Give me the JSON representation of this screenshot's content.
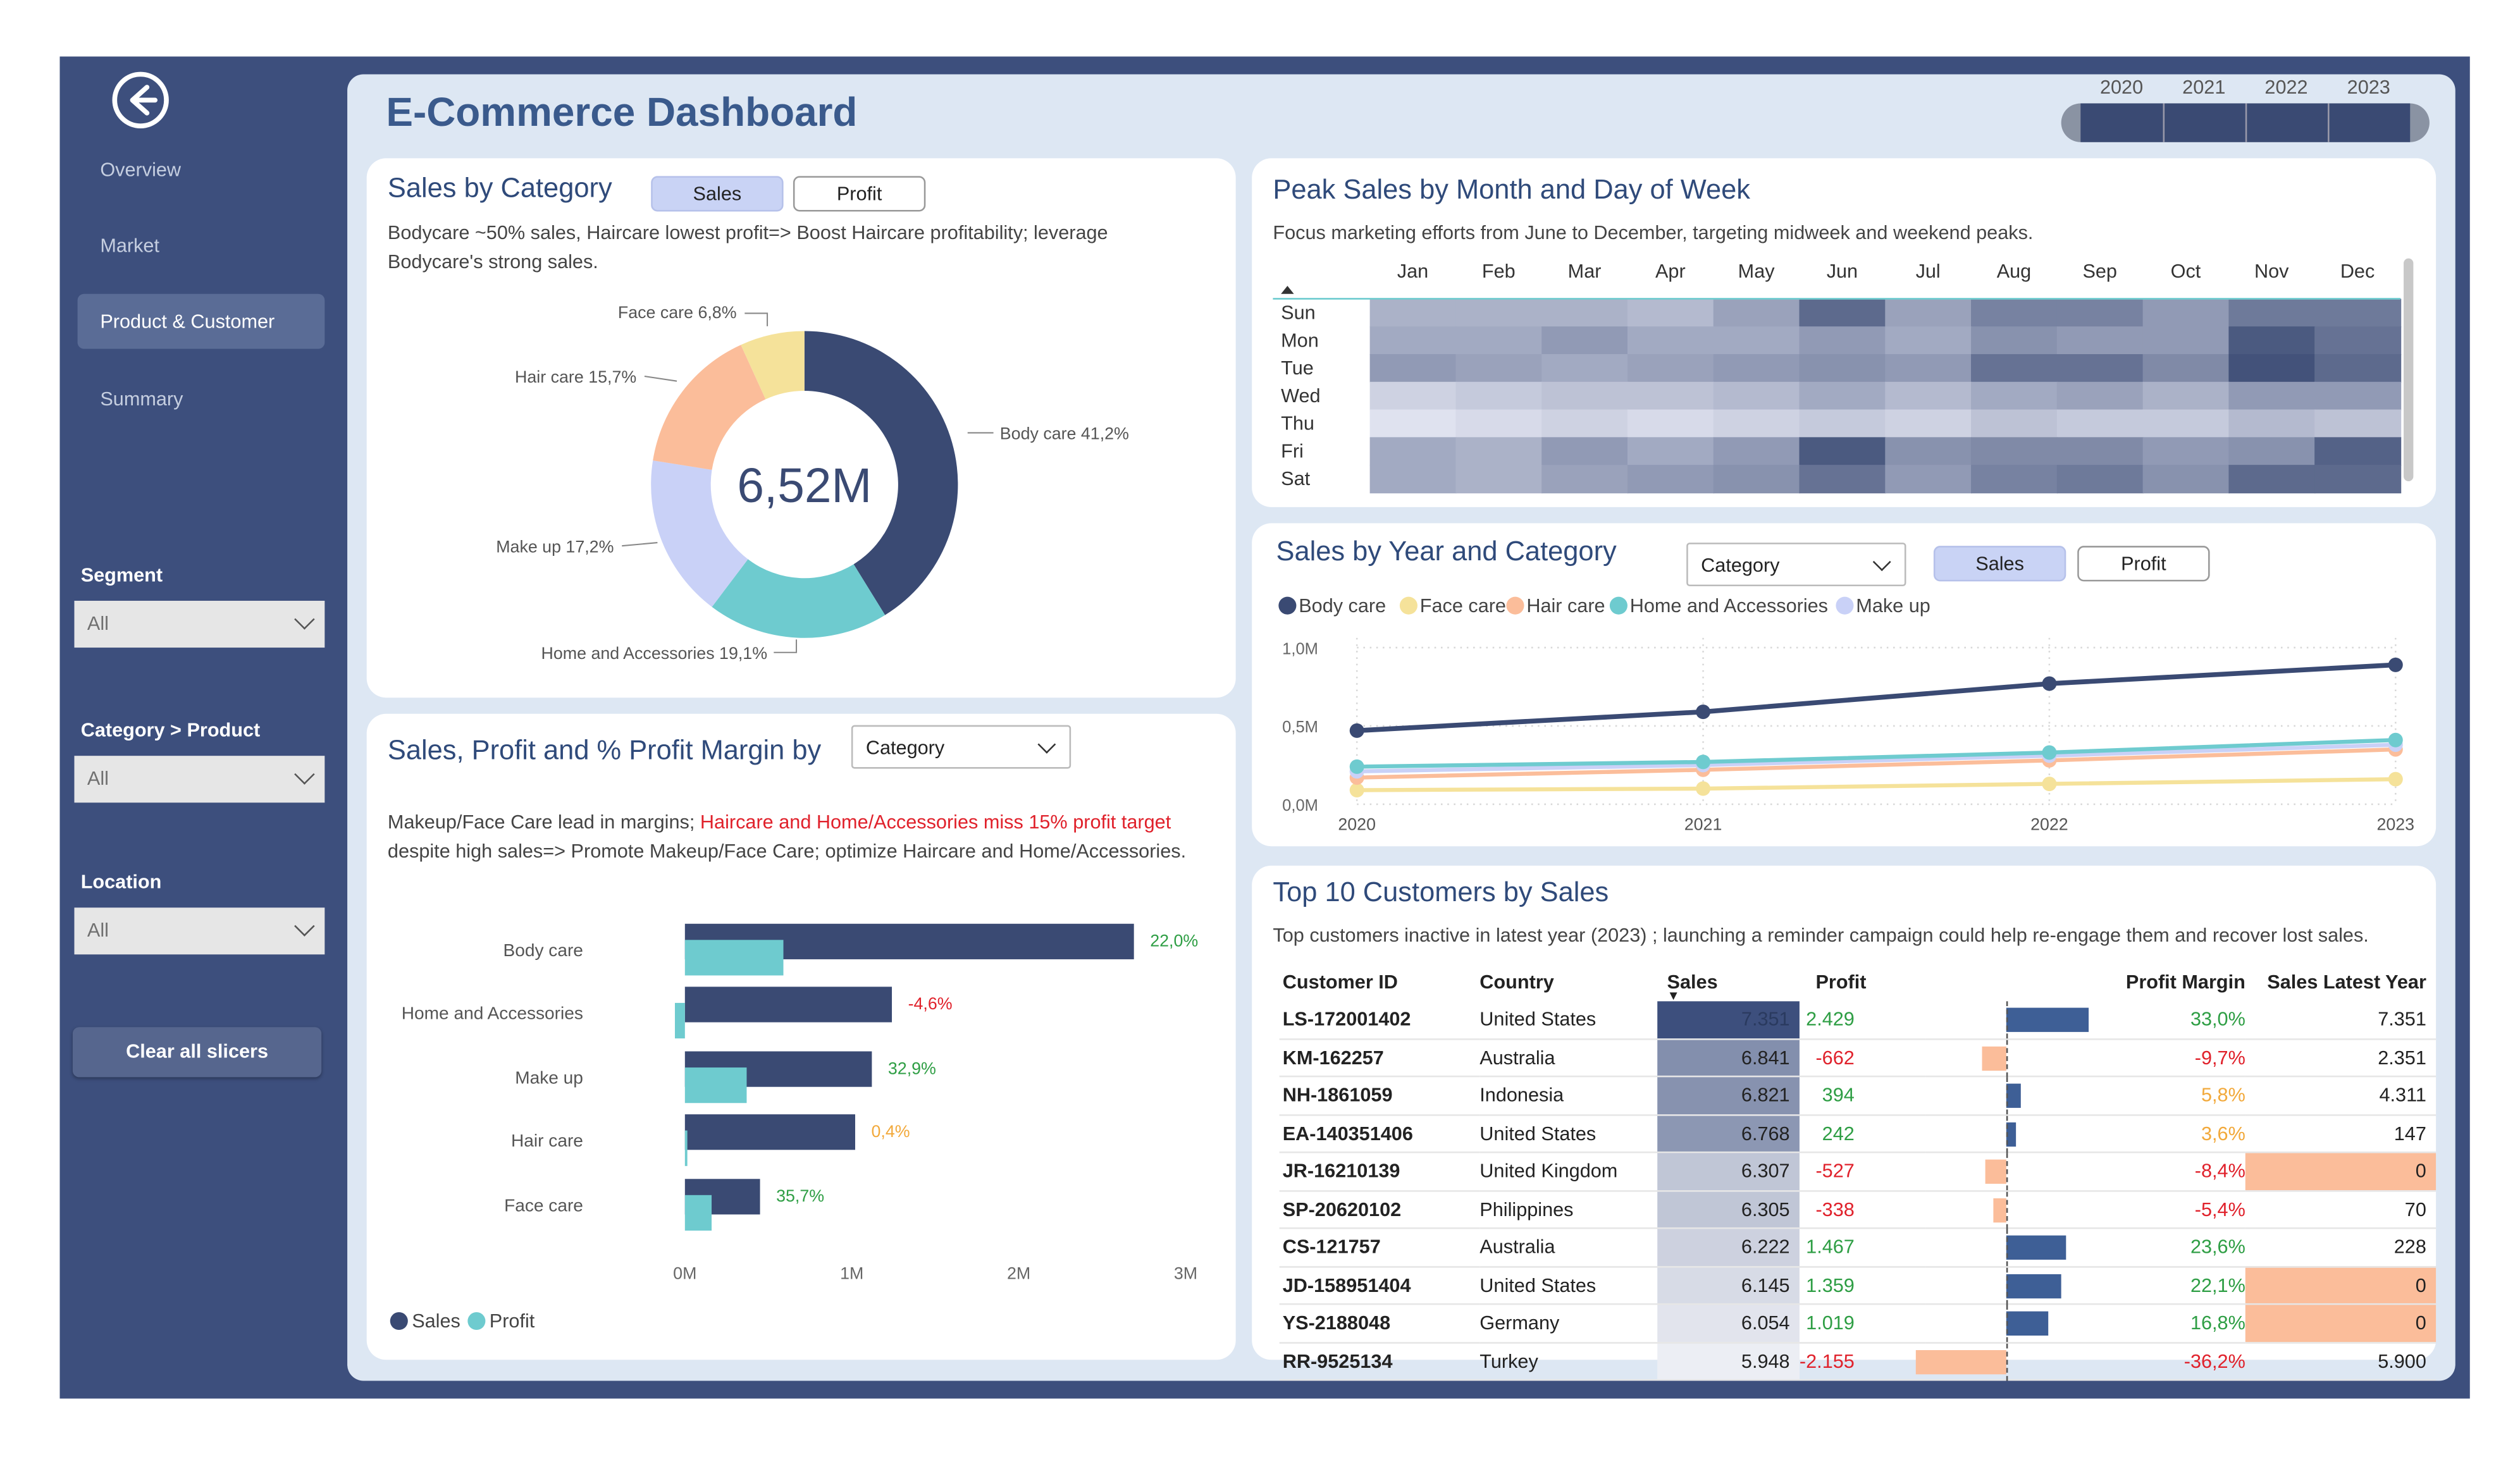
{
  "app": {
    "title": "E-Commerce Dashboard"
  },
  "nav": {
    "items": [
      {
        "label": "Overview"
      },
      {
        "label": "Market"
      },
      {
        "label": "Product & Customer"
      },
      {
        "label": "Summary"
      }
    ],
    "active": "Product & Customer"
  },
  "filters": {
    "segment": {
      "label": "Segment",
      "value": "All"
    },
    "category_product": {
      "label": "Category > Product",
      "value": "All"
    },
    "location": {
      "label": "Location",
      "value": "All"
    },
    "clear_label": "Clear all slicers"
  },
  "year_slider": {
    "years": [
      "2020",
      "2021",
      "2022",
      "2023"
    ]
  },
  "sales_by_category": {
    "title": "Sales by Category",
    "toggle": {
      "sales": "Sales",
      "profit": "Profit",
      "selected": "Sales"
    },
    "desc": "Bodycare ~50% sales, Haircare lowest profit=> Boost Haircare profitability; leverage Bodycare's strong sales.",
    "center_value": "6,52M",
    "slice_labels": [
      "Body care 41,2%",
      "Home and Accessories 19,1%",
      "Make up 17,2%",
      "Hair care 15,7%",
      "Face care 6,8%"
    ]
  },
  "profit_margin": {
    "title": "Sales, Profit and % Profit Margin by",
    "dropdown": "Category",
    "desc_black": "Makeup/Face Care lead in margins; ",
    "desc_red": "Haircare and Home/Accessories miss 15% profit target",
    "desc_black2": "despite high sales=> Promote Makeup/Face Care; optimize Haircare and Home/Accessories.",
    "legend": [
      "Sales",
      "Profit"
    ]
  },
  "peak_sales": {
    "title": "Peak Sales by Month and Day of Week",
    "desc": "Focus marketing efforts from June to December, targeting midweek and weekend peaks."
  },
  "year_category": {
    "title": "Sales by Year and Category",
    "dropdown": "Category",
    "toggle": {
      "sales": "Sales",
      "profit": "Profit",
      "selected": "Sales"
    }
  },
  "top_customers": {
    "title": "Top 10 Customers by Sales",
    "desc": "Top customers inactive in latest year (2023) ; launching a reminder campaign could help re-engage them and recover lost sales.",
    "headers": [
      "Customer ID",
      "Country",
      "Sales",
      "Profit",
      "",
      "Profit Margin",
      "Sales Latest Year"
    ],
    "rows": [
      {
        "id": "LS-172001402",
        "country": "United States",
        "sales": "7.351",
        "profit": "2.429",
        "margin": "33,0%",
        "latest": "7.351",
        "margin_val": 33.0,
        "profit_neg": false,
        "latest_zero": false,
        "sales_shade": 1.0
      },
      {
        "id": "KM-162257",
        "country": "Australia",
        "sales": "6.841",
        "profit": "-662",
        "margin": "-9,7%",
        "latest": "2.351",
        "margin_val": -9.7,
        "profit_neg": true,
        "latest_zero": false,
        "sales_shade": 0.6
      },
      {
        "id": "NH-1861059",
        "country": "Indonesia",
        "sales": "6.821",
        "profit": "394",
        "margin": "5,8%",
        "latest": "4.311",
        "margin_val": 5.8,
        "profit_neg": false,
        "latest_zero": false,
        "sales_shade": 0.58
      },
      {
        "id": "EA-140351406",
        "country": "United States",
        "sales": "6.768",
        "profit": "242",
        "margin": "3,6%",
        "latest": "147",
        "margin_val": 3.6,
        "profit_neg": false,
        "latest_zero": false,
        "sales_shade": 0.55
      },
      {
        "id": "JR-16210139",
        "country": "United Kingdom",
        "sales": "6.307",
        "profit": "-527",
        "margin": "-8,4%",
        "latest": "0",
        "margin_val": -8.4,
        "profit_neg": true,
        "latest_zero": true,
        "sales_shade": 0.25
      },
      {
        "id": "SP-20620102",
        "country": "Philippines",
        "sales": "6.305",
        "profit": "-338",
        "margin": "-5,4%",
        "latest": "70",
        "margin_val": -5.4,
        "profit_neg": true,
        "latest_zero": false,
        "sales_shade": 0.25
      },
      {
        "id": "CS-121757",
        "country": "Australia",
        "sales": "6.222",
        "profit": "1.467",
        "margin": "23,6%",
        "latest": "228",
        "margin_val": 23.6,
        "profit_neg": false,
        "latest_zero": false,
        "sales_shade": 0.18
      },
      {
        "id": "JD-158951404",
        "country": "United States",
        "sales": "6.145",
        "profit": "1.359",
        "margin": "22,1%",
        "latest": "0",
        "margin_val": 22.1,
        "profit_neg": false,
        "latest_zero": true,
        "sales_shade": 0.12
      },
      {
        "id": "YS-2188048",
        "country": "Germany",
        "sales": "6.054",
        "profit": "1.019",
        "margin": "16,8%",
        "latest": "0",
        "margin_val": 16.8,
        "profit_neg": false,
        "latest_zero": true,
        "sales_shade": 0.06
      },
      {
        "id": "RR-9525134",
        "country": "Turkey",
        "sales": "5.948",
        "profit": "-2.155",
        "margin": "-36,2%",
        "latest": "5.900",
        "margin_val": -36.2,
        "profit_neg": true,
        "latest_zero": false,
        "sales_shade": 0.0
      }
    ]
  },
  "colors": {
    "navy": "#3d4f7d",
    "dark_bar": "#3a4a73",
    "teal": "#6ecbcf",
    "peach": "#fbbd9a",
    "yellow": "#f5e29a",
    "lavender": "#c9d1f7",
    "green": "#2e9e44",
    "red": "#e0212b",
    "orange": "#f2a93b"
  },
  "chart_data": [
    {
      "type": "pie",
      "title": "Sales by Category",
      "categories": [
        "Body care",
        "Home and Accessories",
        "Make up",
        "Hair care",
        "Face care"
      ],
      "values": [
        41.2,
        19.1,
        17.2,
        15.7,
        6.8
      ],
      "colors": [
        "#3a4a73",
        "#6ecbcf",
        "#c9d1f7",
        "#fbbd9a",
        "#f5e29a"
      ]
    },
    {
      "type": "bar",
      "orientation": "horizontal",
      "categories": [
        "Body care",
        "Home and Accessories",
        "Make up",
        "Hair care",
        "Face care"
      ],
      "series": [
        {
          "name": "Sales",
          "values": [
            2.69,
            1.24,
            1.12,
            1.02,
            0.45
          ]
        },
        {
          "name": "Profit",
          "values": [
            0.59,
            -0.06,
            0.37,
            0.005,
            0.16
          ]
        }
      ],
      "margin_labels": [
        "22,0%",
        "-4,6%",
        "32,9%",
        "0,4%",
        "35,7%"
      ],
      "margin_colors": [
        "#2e9e44",
        "#e0212b",
        "#2e9e44",
        "#f2a93b",
        "#2e9e44"
      ],
      "xticks": [
        "0M",
        "1M",
        "2M",
        "3M"
      ],
      "xlim": [
        0,
        3
      ]
    },
    {
      "type": "heatmap",
      "x": [
        "Jan",
        "Feb",
        "Mar",
        "Apr",
        "May",
        "Jun",
        "Jul",
        "Aug",
        "Sep",
        "Oct",
        "Nov",
        "Dec"
      ],
      "y": [
        "Sun",
        "Mon",
        "Tue",
        "Wed",
        "Thu",
        "Fri",
        "Sat"
      ],
      "values": [
        [
          0.35,
          0.35,
          0.35,
          0.3,
          0.45,
          0.8,
          0.45,
          0.65,
          0.65,
          0.5,
          0.7,
          0.7
        ],
        [
          0.4,
          0.4,
          0.5,
          0.4,
          0.4,
          0.5,
          0.4,
          0.55,
          0.5,
          0.5,
          0.9,
          0.75
        ],
        [
          0.5,
          0.45,
          0.4,
          0.45,
          0.5,
          0.55,
          0.5,
          0.75,
          0.75,
          0.6,
          0.95,
          0.8
        ],
        [
          0.15,
          0.2,
          0.25,
          0.25,
          0.3,
          0.4,
          0.3,
          0.4,
          0.45,
          0.35,
          0.5,
          0.5
        ],
        [
          0.05,
          0.1,
          0.15,
          0.1,
          0.15,
          0.2,
          0.15,
          0.25,
          0.2,
          0.2,
          0.3,
          0.25
        ],
        [
          0.4,
          0.35,
          0.5,
          0.4,
          0.5,
          0.9,
          0.55,
          0.6,
          0.6,
          0.5,
          0.55,
          0.85
        ],
        [
          0.4,
          0.35,
          0.45,
          0.5,
          0.55,
          0.75,
          0.5,
          0.65,
          0.7,
          0.55,
          0.8,
          0.8
        ]
      ]
    },
    {
      "type": "line",
      "title": "Sales by Year and Category",
      "x": [
        "2020",
        "2021",
        "2022",
        "2023"
      ],
      "series": [
        {
          "name": "Body care",
          "values": [
            0.47,
            0.59,
            0.77,
            0.89
          ],
          "color": "#3a4a73"
        },
        {
          "name": "Face care",
          "values": [
            0.09,
            0.1,
            0.13,
            0.16
          ],
          "color": "#f5e29a"
        },
        {
          "name": "Hair care",
          "values": [
            0.17,
            0.22,
            0.28,
            0.35
          ],
          "color": "#fbbd9a"
        },
        {
          "name": "Home and Accessories",
          "values": [
            0.24,
            0.27,
            0.33,
            0.41
          ],
          "color": "#6ecbcf"
        },
        {
          "name": "Make up",
          "values": [
            0.21,
            0.25,
            0.31,
            0.38
          ],
          "color": "#c9d1f7"
        }
      ],
      "yticks": [
        "0,0M",
        "0,5M",
        "1,0M"
      ],
      "ylim": [
        0,
        1.0
      ]
    }
  ]
}
